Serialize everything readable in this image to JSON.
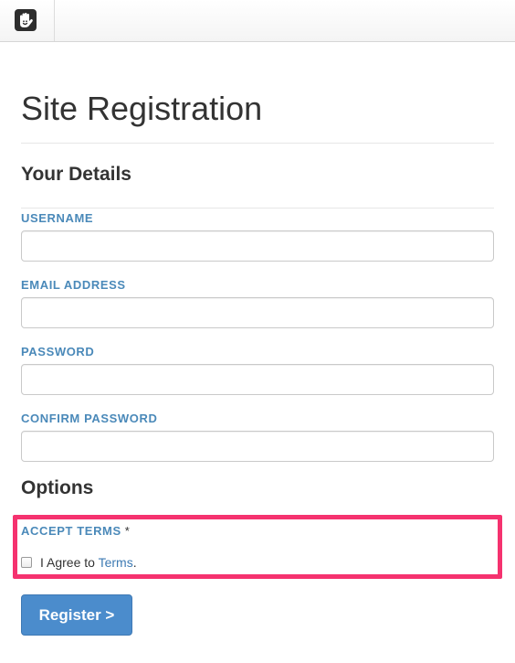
{
  "topbar": {
    "logo_icon": "concrete5-hand-logo-icon"
  },
  "page": {
    "title": "Site Registration"
  },
  "sections": {
    "details_heading": "Your Details",
    "options_heading": "Options"
  },
  "fields": {
    "username": {
      "label": "USERNAME",
      "value": ""
    },
    "email": {
      "label": "EMAIL ADDRESS",
      "value": ""
    },
    "password": {
      "label": "PASSWORD",
      "value": ""
    },
    "confirm_password": {
      "label": "CONFIRM PASSWORD",
      "value": ""
    }
  },
  "options": {
    "accept_terms_label": "ACCEPT TERMS",
    "required_marker": "*",
    "agree_prefix": "I Agree to ",
    "terms_link_text": "Terms",
    "agree_suffix": ".",
    "checked": false
  },
  "actions": {
    "register_label": "Register >"
  },
  "colors": {
    "label_blue": "#4a89b9",
    "button_blue": "#4b8ccc",
    "highlight_pink": "#f5326f"
  }
}
